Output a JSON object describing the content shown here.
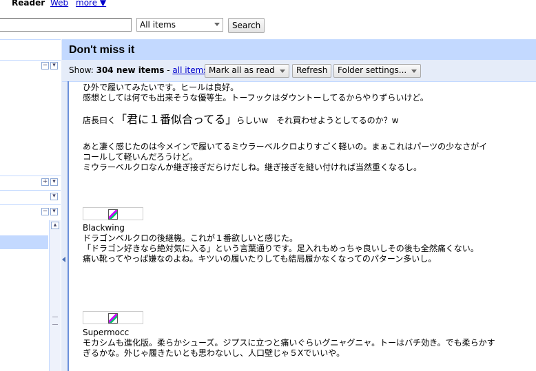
{
  "topnav": {
    "reader": "Reader",
    "web": "Web",
    "more": "more ▼"
  },
  "search": {
    "filter_value": "All items",
    "button": "Search"
  },
  "header": {
    "title": "Don't miss it"
  },
  "viewbar": {
    "show_label": "Show:",
    "new_items": "304 new items",
    "separator": " - ",
    "all_items": "all items",
    "mark_all": "Mark all as read",
    "refresh": "Refresh",
    "folder_settings": "Folder settings..."
  },
  "entry1": {
    "line1": "ひ外で履いてみたいです。ヒールは良好。",
    "line2": "感想としては何でも出来そうな優等生。トーフックはダウントーしてるからやりずらいけど。",
    "line3_prefix": "店長曰く",
    "line3_big": "「君に１番似合ってる」",
    "line3_suffix": "らしいw　それ買わせようとしてるのか？w",
    "line4": "あと凄く感じたのは今メインで履いてるミウラーベルクロよりすごく軽いの。まぁこれはパーツの少なさがイ",
    "line5": "コールして軽いんだろうけど。",
    "line6": "ミウラーベルクロなんか継ぎ接ぎだらけだしね。継ぎ接ぎを縫い付ければ当然重くなるし。"
  },
  "entry2": {
    "name": "Blackwing",
    "line1": "ドラゴンベルクロの後継機。これが１番欲しいと感じた。",
    "line2": "「ドラゴン好きなら絶対気に入る」という言葉通りです。足入れもめっちゃ良いしその後も全然痛くない。",
    "line3": "痛い靴ってやっぱ嫌なのよね。キツいの履いたりしても結局履かなくなってのパターン多いし。"
  },
  "entry3": {
    "name": "Supermocc",
    "line1": "モカシムも進化版。柔らかシューズ。ジプスに立つと痛いぐらいグニャグニャ。トーはバチ効き。でも柔らかす",
    "line2": "ぎるかな。外じゃ履きたいとも思わないし、人口壁じゃ５Xでいいや。"
  }
}
